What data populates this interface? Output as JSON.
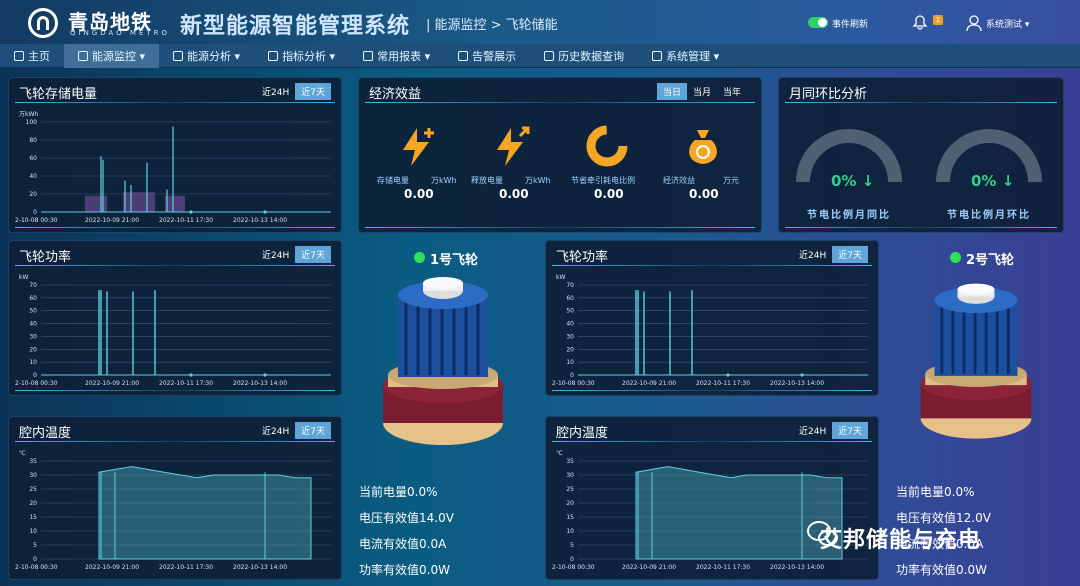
{
  "header": {
    "logo_cn": "青岛地铁",
    "logo_en": "QINGDAO METRO",
    "system_title": "新型能源智能管理系统",
    "breadcrumb": "| 能源监控 > 飞轮储能",
    "event_refresh": "事件刷新",
    "badge": "1",
    "user": "系统测试 ▾"
  },
  "nav": [
    {
      "label": "主页",
      "icon": "home-icon"
    },
    {
      "label": "能源监控 ▾",
      "icon": "monitor-icon",
      "active": true
    },
    {
      "label": "能源分析 ▾",
      "icon": "analysis-icon"
    },
    {
      "label": "指标分析 ▾",
      "icon": "indicator-icon"
    },
    {
      "label": "常用报表 ▾",
      "icon": "report-icon"
    },
    {
      "label": "告警展示",
      "icon": "alarm-icon"
    },
    {
      "label": "历史数据查询",
      "icon": "history-icon"
    },
    {
      "label": "系统管理 ▾",
      "icon": "settings-icon"
    }
  ],
  "range": {
    "h24": "近24H",
    "d7": "近7天"
  },
  "storage": {
    "title": "飞轮存储电量",
    "unit": "万kWh",
    "yticks": [
      "100",
      "80",
      "60",
      "40",
      "20",
      "0"
    ],
    "xticks": [
      "2-10-08 00:30",
      "2022-10-09 21:00",
      "2022-10-11 17:30",
      "2022-10-13 14:00"
    ]
  },
  "power": {
    "title": "飞轮功率",
    "unit": "kW",
    "yticks": [
      "70",
      "60",
      "50",
      "40",
      "30",
      "20",
      "10",
      "0"
    ],
    "xticks": [
      "2-10-08 00:30",
      "2022-10-09 21:00",
      "2022-10-11 17:30",
      "2022-10-13 14:00"
    ]
  },
  "temp": {
    "title": "腔内温度",
    "unit": "℃",
    "yticks": [
      "35",
      "30",
      "25",
      "20",
      "15",
      "10",
      "5",
      "0"
    ],
    "xticks": [
      "2-10-08 00:30",
      "2022-10-09 21:00",
      "2022-10-11 17:30",
      "2022-10-13 14:00"
    ]
  },
  "economy": {
    "title": "经济效益",
    "tabs": [
      "当日",
      "当月",
      "当年"
    ],
    "items": [
      {
        "label": "存储电量",
        "unit": "万kWh",
        "value": "0.00",
        "icon": "charge-bolt-icon"
      },
      {
        "label": "释放电量",
        "unit": "万kWh",
        "value": "0.00",
        "icon": "discharge-bolt-icon"
      },
      {
        "label": "节省牵引耗电比例",
        "unit": "",
        "value": "0.00",
        "icon": "ratio-icon"
      },
      {
        "label": "经济效益",
        "unit": "万元",
        "value": "0.00",
        "icon": "money-bag-icon"
      }
    ]
  },
  "monthly": {
    "title": "月同环比分析",
    "gauges": [
      {
        "pct": "0% ↓",
        "label": "节电比例月同比",
        "value": 0
      },
      {
        "pct": "0% ↓",
        "label": "节电比例月环比",
        "value": 0
      }
    ]
  },
  "flywheel1": {
    "title": "1号飞轮",
    "stats": [
      "当前电量0.0%",
      "电压有效值14.0V",
      "电流有效值0.0A",
      "功率有效值0.0W"
    ]
  },
  "flywheel2": {
    "title": "2号飞轮",
    "stats": [
      "当前电量0.0%",
      "电压有效值12.0V",
      "电流有效值0.0A",
      "功率有效值0.0W"
    ]
  },
  "watermark": "艾邦储能与充电",
  "colors": {
    "accent": "#3ab6ff",
    "green": "#2fd08a",
    "orange": "#f5a623",
    "chart_line": "#5fd0e0"
  },
  "chart_data": [
    {
      "type": "bar",
      "title": "飞轮存储电量",
      "ylabel": "万kWh",
      "ylim": [
        0,
        100
      ],
      "x": [
        "2022-10-08",
        "2022-10-09",
        "2022-10-10",
        "2022-10-11",
        "2022-10-12",
        "2022-10-13"
      ],
      "series": [
        {
          "values": [
            0,
            75,
            60,
            95,
            0,
            0
          ]
        }
      ]
    },
    {
      "type": "line",
      "title": "飞轮功率",
      "ylabel": "kW",
      "ylim": [
        0,
        70
      ],
      "series": [
        {
          "values": [
            0,
            66,
            65,
            0,
            65,
            0,
            66,
            0,
            0,
            0
          ]
        }
      ]
    },
    {
      "type": "area",
      "title": "腔内温度",
      "ylabel": "℃",
      "ylim": [
        0,
        35
      ],
      "series": [
        {
          "values": [
            0,
            31,
            32,
            33,
            32,
            31,
            30,
            29,
            30,
            30,
            30,
            30,
            30,
            29,
            29
          ]
        }
      ]
    }
  ]
}
